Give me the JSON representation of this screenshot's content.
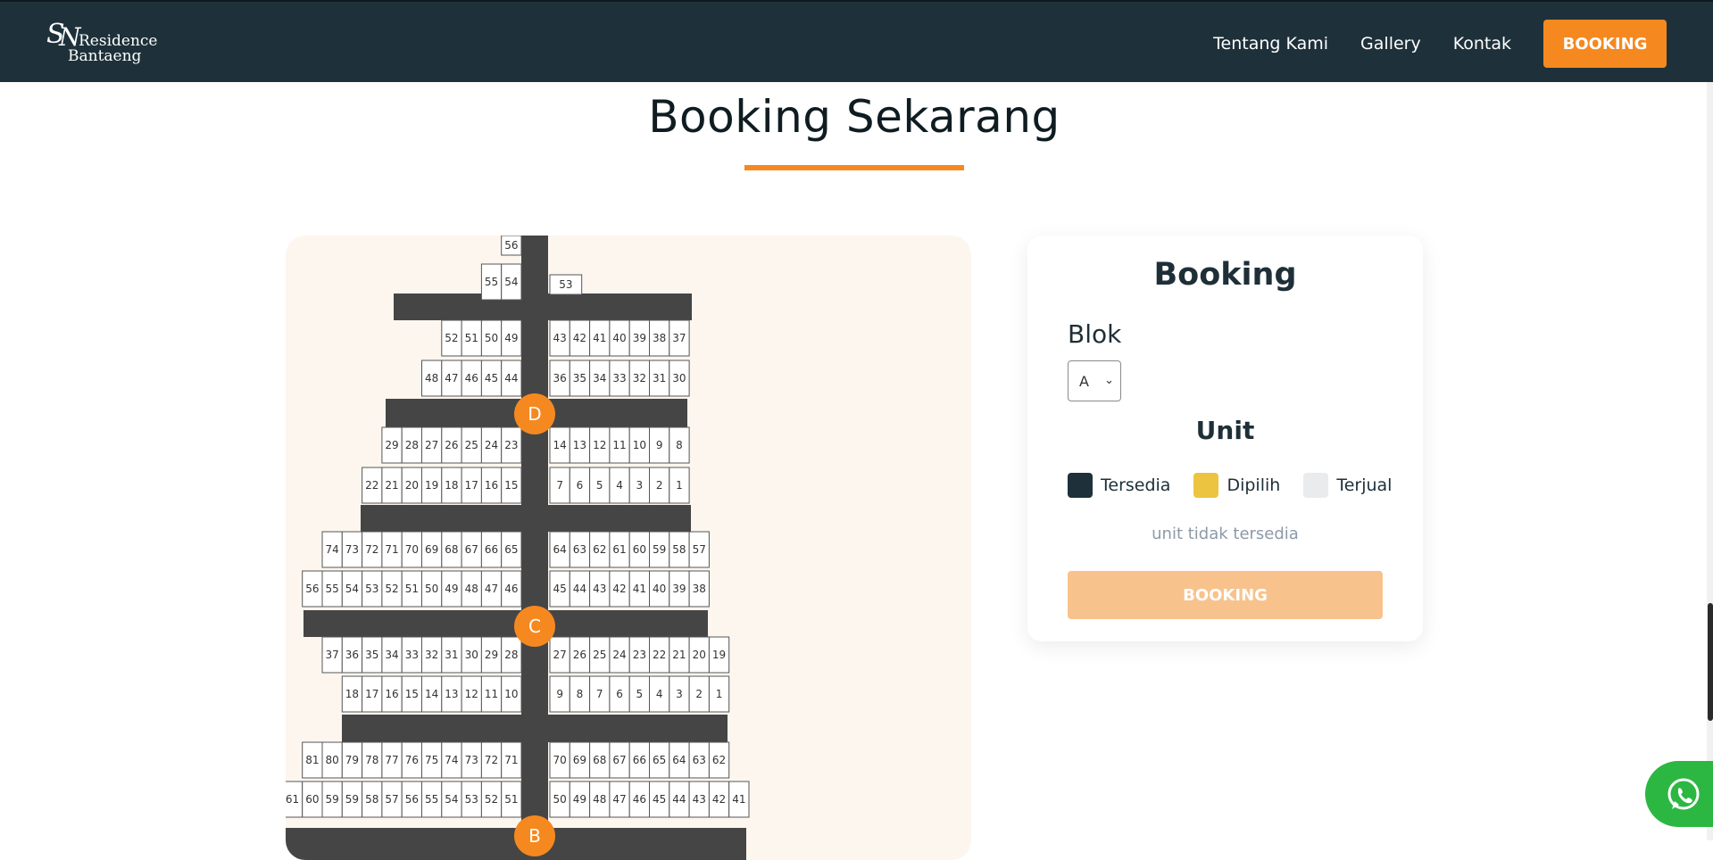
{
  "header": {
    "logo_text_line1": "SN Residence",
    "logo_text_line2": "Bantaeng",
    "nav": [
      "Tentang Kami",
      "Gallery",
      "Kontak"
    ],
    "cta": "BOOKING"
  },
  "section": {
    "title": "Booking Sekarang"
  },
  "siteplan": {
    "blocks": [
      {
        "label": "D",
        "rows": [
          {
            "left": [
              "56"
            ],
            "right": []
          },
          {
            "left": [
              "55",
              "54"
            ],
            "right": [
              "53"
            ]
          },
          {
            "left": [
              "52",
              "51",
              "50",
              "49"
            ],
            "right": [
              "43",
              "42",
              "41",
              "40",
              "39",
              "38",
              "37"
            ]
          },
          {
            "left": [
              "48",
              "47",
              "46",
              "45",
              "44"
            ],
            "right": [
              "36",
              "35",
              "34",
              "33",
              "32",
              "31",
              "30"
            ]
          },
          {
            "left": [
              "29",
              "28",
              "27",
              "26",
              "25",
              "24",
              "23"
            ],
            "right": [
              "14",
              "13",
              "12",
              "11",
              "10",
              "9",
              "8"
            ]
          },
          {
            "left": [
              "22",
              "21",
              "20",
              "19",
              "18",
              "17",
              "16",
              "15"
            ],
            "right": [
              "7",
              "6",
              "5",
              "4",
              "3",
              "2",
              "1"
            ]
          }
        ]
      },
      {
        "label": "C",
        "rows": [
          {
            "left": [
              "74",
              "73",
              "72",
              "71",
              "70",
              "69",
              "68",
              "67",
              "66",
              "65"
            ],
            "right": [
              "64",
              "63",
              "62",
              "61",
              "60",
              "59",
              "58",
              "57"
            ]
          },
          {
            "left": [
              "56",
              "55",
              "54",
              "53",
              "52",
              "51",
              "50",
              "49",
              "48",
              "47",
              "46"
            ],
            "right": [
              "45",
              "44",
              "43",
              "42",
              "41",
              "40",
              "39",
              "38"
            ]
          },
          {
            "left": [
              "37",
              "36",
              "35",
              "34",
              "33",
              "32",
              "31",
              "30",
              "29",
              "28"
            ],
            "right": [
              "27",
              "26",
              "25",
              "24",
              "23",
              "22",
              "21",
              "20",
              "19"
            ]
          },
          {
            "left": [
              "18",
              "17",
              "16",
              "15",
              "14",
              "13",
              "12",
              "11",
              "10"
            ],
            "right": [
              "9",
              "8",
              "7",
              "6",
              "5",
              "4",
              "3",
              "2",
              "1"
            ]
          }
        ]
      },
      {
        "label": "B",
        "rows": [
          {
            "left": [
              "81",
              "80",
              "79",
              "78",
              "77",
              "76",
              "75",
              "74",
              "73",
              "72",
              "71"
            ],
            "right": [
              "70",
              "69",
              "68",
              "67",
              "66",
              "65",
              "64",
              "63",
              "62"
            ]
          },
          {
            "left": [
              "61",
              "60",
              "59",
              "59",
              "58",
              "57",
              "56",
              "55",
              "54",
              "53",
              "52",
              "51"
            ],
            "right": [
              "50",
              "49",
              "48",
              "47",
              "46",
              "45",
              "44",
              "43",
              "42",
              "41"
            ]
          }
        ]
      }
    ]
  },
  "booking": {
    "title": "Booking",
    "blok_label": "Blok",
    "blok_value": "A",
    "unit_label": "Unit",
    "legend": [
      {
        "label": "Tersedia",
        "color": "#1e313a"
      },
      {
        "label": "Dipilih",
        "color": "#ecc440"
      },
      {
        "label": "Terjual",
        "color": "#e9ebec"
      }
    ],
    "empty_message": "unit tidak tersedia",
    "button": "BOOKING"
  },
  "colors": {
    "primary": "#1e313a",
    "accent": "#f5891f",
    "road": "#454545",
    "marker": "#f5891f"
  },
  "icons": {
    "whatsapp": "whatsapp-icon",
    "select": "chevron-down-icon"
  }
}
